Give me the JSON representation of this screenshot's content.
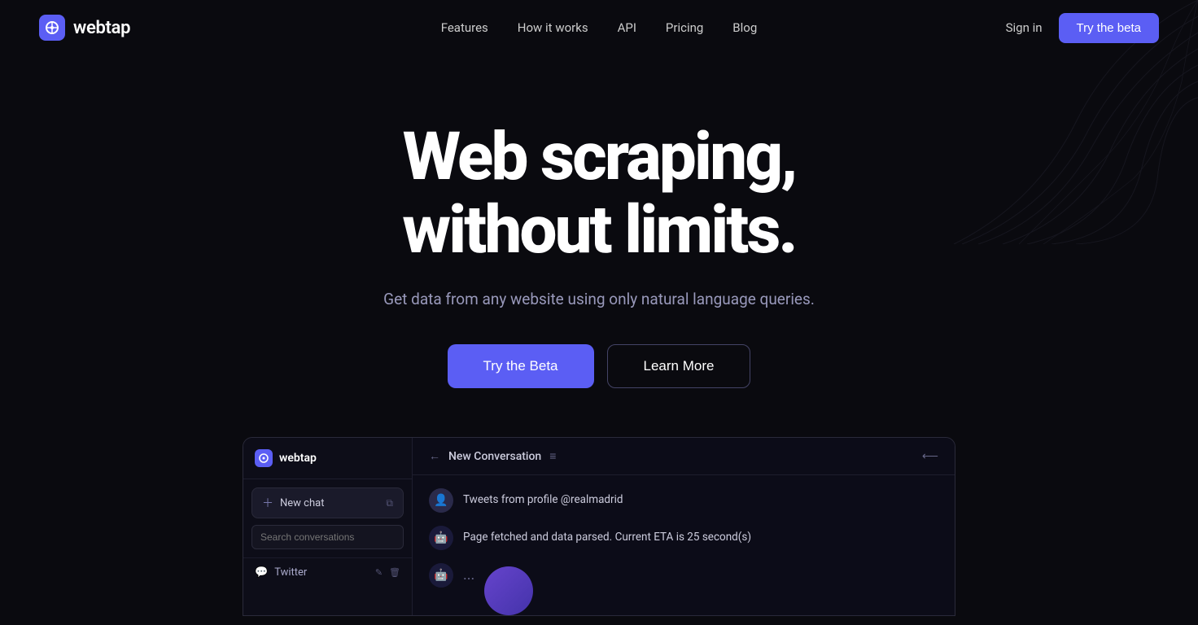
{
  "nav": {
    "logo_text": "webtap",
    "links": [
      {
        "label": "Features",
        "id": "features"
      },
      {
        "label": "How it works",
        "id": "how-it-works"
      },
      {
        "label": "API",
        "id": "api"
      },
      {
        "label": "Pricing",
        "id": "pricing"
      },
      {
        "label": "Blog",
        "id": "blog"
      }
    ],
    "sign_in": "Sign in",
    "try_beta": "Try the beta"
  },
  "hero": {
    "title_line1": "Web scraping,",
    "title_line2": "without limits.",
    "subtitle": "Get data from any website using only natural language queries.",
    "cta_primary": "Try the Beta",
    "cta_secondary": "Learn More"
  },
  "demo": {
    "sidebar": {
      "logo_text": "webtap",
      "new_chat_label": "New chat",
      "search_placeholder": "Search conversations",
      "conversation_item": "Twitter"
    },
    "chat": {
      "header_title": "New Conversation",
      "message1": "Tweets from profile @realmadrid",
      "message2": "Page fetched and data parsed. Current ETA is 25 second(s)",
      "dots": "..."
    }
  }
}
